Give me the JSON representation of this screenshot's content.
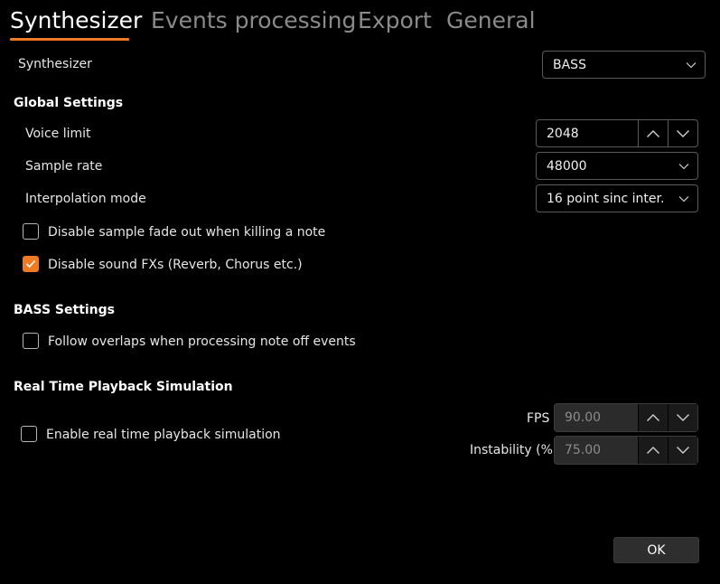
{
  "tabs": [
    {
      "label": "Synthesizer",
      "active": true
    },
    {
      "label": "Events processing",
      "active": false
    },
    {
      "label": "Export",
      "active": false
    },
    {
      "label": "General",
      "active": false
    }
  ],
  "synth": {
    "label": "Synthesizer",
    "value": "BASS"
  },
  "global": {
    "title": "Global Settings",
    "voice_limit": {
      "label": "Voice limit",
      "value": "2048"
    },
    "sample_rate": {
      "label": "Sample rate",
      "value": "48000"
    },
    "interpolation": {
      "label": "Interpolation mode",
      "value": "16 point sinc inter."
    },
    "fade_out": {
      "label": "Disable sample fade out when killing a note",
      "checked": false
    },
    "sound_fx": {
      "label": "Disable sound FXs (Reverb, Chorus etc.)",
      "checked": true
    }
  },
  "bass": {
    "title": "BASS Settings",
    "overlaps": {
      "label": "Follow overlaps when processing note off events",
      "checked": false
    }
  },
  "realtime": {
    "title": "Real Time Playback Simulation",
    "enable": {
      "label": "Enable real time playback simulation",
      "checked": false
    },
    "fps": {
      "label": "FPS",
      "value": "90.00"
    },
    "instability": {
      "label": "Instability (%)",
      "value": "75.00"
    }
  },
  "ok_label": "OK",
  "colors": {
    "accent": "#f07a22",
    "background": "#000000"
  }
}
